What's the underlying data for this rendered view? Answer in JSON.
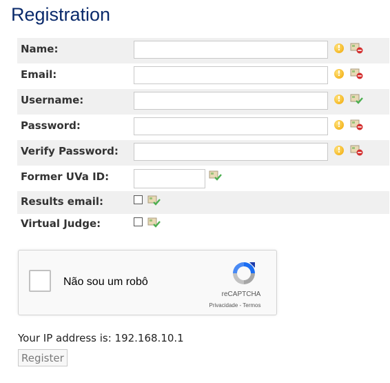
{
  "page": {
    "title": "Registration"
  },
  "form": {
    "name": {
      "label": "Name:",
      "value": "",
      "status": "invalid"
    },
    "email": {
      "label": "Email:",
      "value": "",
      "status": "invalid"
    },
    "username": {
      "label": "Username:",
      "value": "",
      "status": "valid"
    },
    "password": {
      "label": "Password:",
      "value": "",
      "status": "invalid"
    },
    "verify_password": {
      "label": "Verify Password:",
      "value": "",
      "status": "invalid"
    },
    "former_uva_id": {
      "label": "Former UVa ID:",
      "value": "",
      "status": "valid"
    },
    "results_email": {
      "label": "Results email:",
      "checked": false,
      "status": "valid"
    },
    "virtual_judge": {
      "label": "Virtual Judge:",
      "checked": false,
      "status": "valid"
    },
    "warning_glyph": "!"
  },
  "recaptcha": {
    "label": "Não sou um robô",
    "brand": "reCAPTCHA",
    "links": "Privacidade - Termos"
  },
  "ip_line": "Your IP address is: 192.168.10.1",
  "register_button": "Register",
  "colors": {
    "title": "#0a2a6b",
    "row_alt": "#f0f0f0",
    "warning": "#f0a500",
    "valid_check": "#4caf50",
    "invalid_mark": "#d32f2f"
  },
  "icons": [
    "warning-icon",
    "field-invalid-icon",
    "field-valid-icon",
    "recaptcha-logo-icon"
  ]
}
